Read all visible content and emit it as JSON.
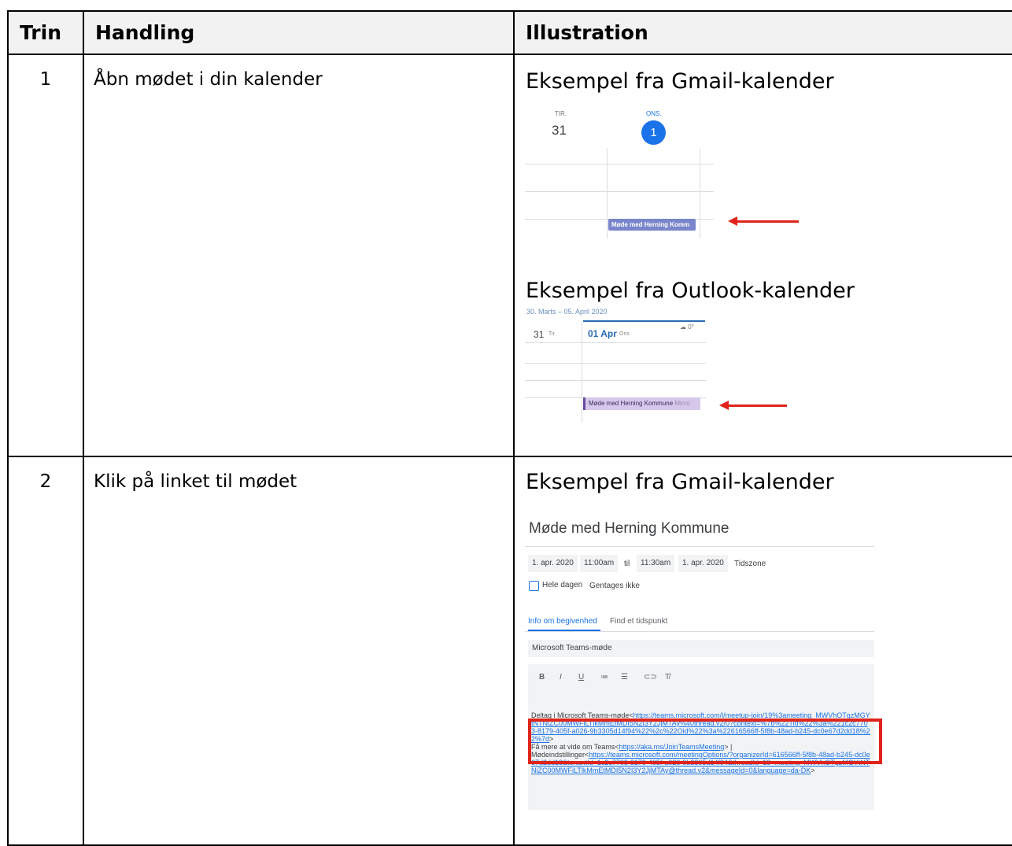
{
  "table": {
    "headers": {
      "step": "Trin",
      "action": "Handling",
      "illustration": "Illustration"
    },
    "rows": [
      {
        "step": "1",
        "action": "Åbn mødet i din kalender"
      },
      {
        "step": "2",
        "action": "Klik på linket til mødet"
      }
    ]
  },
  "illustrations": {
    "gmail_heading": "Eksempel fra Gmail-kalender",
    "outlook_heading": "Eksempel fra Outlook-kalender",
    "gmail_calendar": {
      "day1_label": "TIR.",
      "day1_num": "31",
      "day2_label": "ONS.",
      "day2_num": "1",
      "event": "Møde med Herning Komm"
    },
    "outlook_calendar": {
      "range": "30. Marts – 05. April 2020",
      "weather": "☁ 0°",
      "day1": "31",
      "day1_name": "Tir",
      "day2": "01 Apr",
      "day2_name": "Ons",
      "event": "Møde med Herning Kommune",
      "event_suffix": "Micro"
    },
    "gmail_detail": {
      "heading": "Eksempel fra Gmail-kalender",
      "title": "Møde med Herning Kommune",
      "start_date": "1. apr. 2020",
      "start_time": "11:00am",
      "til": "til",
      "end_time": "11:30am",
      "end_date": "1. apr. 2020",
      "timezone": "Tidszone",
      "all_day": "Hele dagen",
      "repeat": "Gentages ikke",
      "tab_info": "Info om begivenhed",
      "tab_find": "Find et tidspunkt",
      "location": "Microsoft Teams-møde",
      "format_buttons": [
        "B",
        "I",
        "U",
        "≔",
        "☰",
        "⊂⊃",
        "T̸"
      ],
      "desc_join_label": "Deltag i Microsoft Teams-møde<",
      "desc_join_link": "https://teams.microsoft.com/l/meetup-join/19%3ameeting_MWVhOTgzMGYtNTNiZC00MWFiLTlkMmEtMDI5N2I3Y2JjMTAy%40thread.v2/0?context=%7b%22Tid%22%3a%221c2c7703-8179-405f-a026-9b3305d14f94%22%2c%22Oid%22%3a%22616566ff-5f8b-48ad-b245-dc0e67d2dd18%22%7d",
      "desc_join_end": ">",
      "desc_more_label": "Få mere at vide om Teams<",
      "desc_more_link": "https://aka.ms/JoinTeamsMeeting",
      "desc_more_end": "> |",
      "desc_opts_label": "Mødeindstillinger<",
      "desc_opts_link": "https://teams.microsoft.com/meetingOptions/?organizerId=616566ff-5f8b-48ad-b245-dc0e67d2dd18&tenantId=1c2c7703-8179-405f-a026-9b3305d14f94&threadId=19_meeting_MWVhOTgzMGYtNTNiZC00MWFiLTlkMmEtMDI5N2I3Y2JjMTAy@thread.v2&messageId=0&language=da-DK",
      "desc_opts_end": ">"
    }
  },
  "colors": {
    "highlight": "#e0241b",
    "gmail_blue": "#1a73e8",
    "event_purple": "#7986cb"
  }
}
